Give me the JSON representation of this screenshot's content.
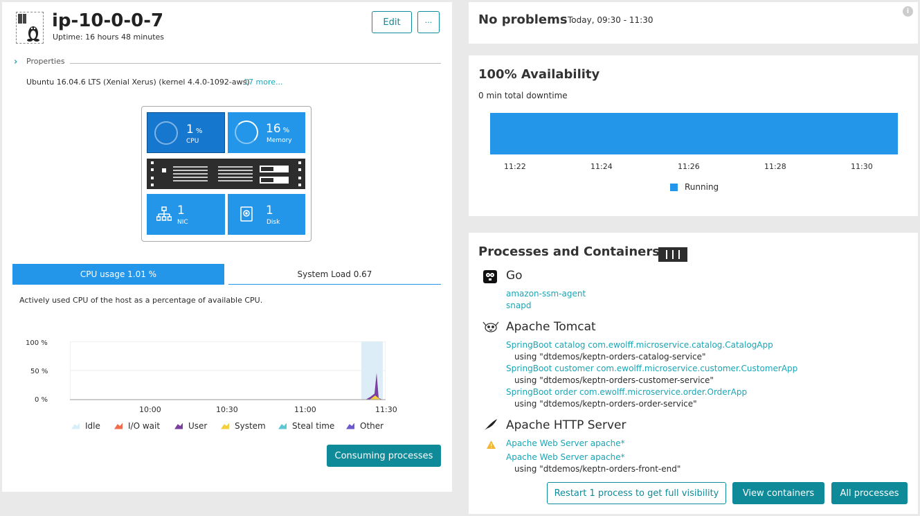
{
  "host": {
    "name": "ip-10-0-0-7",
    "uptime": "Uptime: 16 hours 48 minutes",
    "edit_label": "Edit",
    "more_label": "···",
    "properties_label": "Properties",
    "os": "Ubuntu 16.04.6 LTS (Xenial Xerus) (kernel 4.4.0-1092-aws)",
    "more_props": "17 more..."
  },
  "tiles": {
    "cpu": {
      "value": "1",
      "unit": "%",
      "label": "CPU",
      "fraction": 0.01
    },
    "memory": {
      "value": "16",
      "unit": "%",
      "label": "Memory",
      "fraction": 0.16
    },
    "nic": {
      "value": "1",
      "label": "NIC"
    },
    "disk": {
      "value": "1",
      "label": "Disk"
    }
  },
  "tabs": {
    "cpu": "CPU usage 1.01 %",
    "load": "System Load 0.67"
  },
  "cpu_description": "Actively used CPU of the host as a percentage of available CPU.",
  "chart_data": {
    "type": "area",
    "x_ticks": [
      "10:00",
      "10:30",
      "11:00",
      "11:30"
    ],
    "y_ticks": [
      "100 %",
      "50 %",
      "0 %"
    ],
    "ylim": [
      0,
      100
    ],
    "series_legend": [
      {
        "name": "Idle",
        "color": "#d8eef9"
      },
      {
        "name": "I/O wait",
        "color": "#ef6d4a"
      },
      {
        "name": "User",
        "color": "#7b3fa0"
      },
      {
        "name": "System",
        "color": "#f4d03f"
      },
      {
        "name": "Steal time",
        "color": "#5cc8d6"
      },
      {
        "name": "Other",
        "color": "#6a5acd"
      }
    ],
    "user_peak_percent": 46
  },
  "consuming_label": "Consuming processes",
  "problems": {
    "title": "No problems",
    "timeframe": "Today, 09:30 - 11:30"
  },
  "availability": {
    "title": "100% Availability",
    "downtime": "0 min total downtime",
    "x_ticks": [
      "11:22",
      "11:24",
      "11:26",
      "11:28",
      "11:30"
    ],
    "legend": "Running",
    "color": "#2496ea",
    "running_fraction": 1.0
  },
  "processes": {
    "title": "Processes and Containers",
    "groups": [
      {
        "name": "Go",
        "items": [
          {
            "label": "amazon-ssm-agent"
          },
          {
            "label": "snapd"
          }
        ]
      },
      {
        "name": "Apache Tomcat",
        "items": [
          {
            "label": "SpringBoot catalog com.ewolff.microservice.catalog.CatalogApp",
            "using": "using \"dtdemos/keptn-orders-catalog-service\""
          },
          {
            "label": "SpringBoot customer com.ewolff.microservice.customer.CustomerApp",
            "using": "using \"dtdemos/keptn-orders-customer-service\""
          },
          {
            "label": "SpringBoot order com.ewolff.microservice.order.OrderApp",
            "using": "using \"dtdemos/keptn-orders-order-service\""
          }
        ]
      },
      {
        "name": "Apache HTTP Server",
        "items": [
          {
            "label": "Apache Web Server apache*"
          },
          {
            "label": "Apache Web Server apache*",
            "using": "using \"dtdemos/keptn-orders-front-end\""
          }
        ]
      }
    ],
    "restart_label": "Restart 1 process to get full visibility",
    "view_containers_label": "View containers",
    "all_processes_label": "All processes"
  }
}
